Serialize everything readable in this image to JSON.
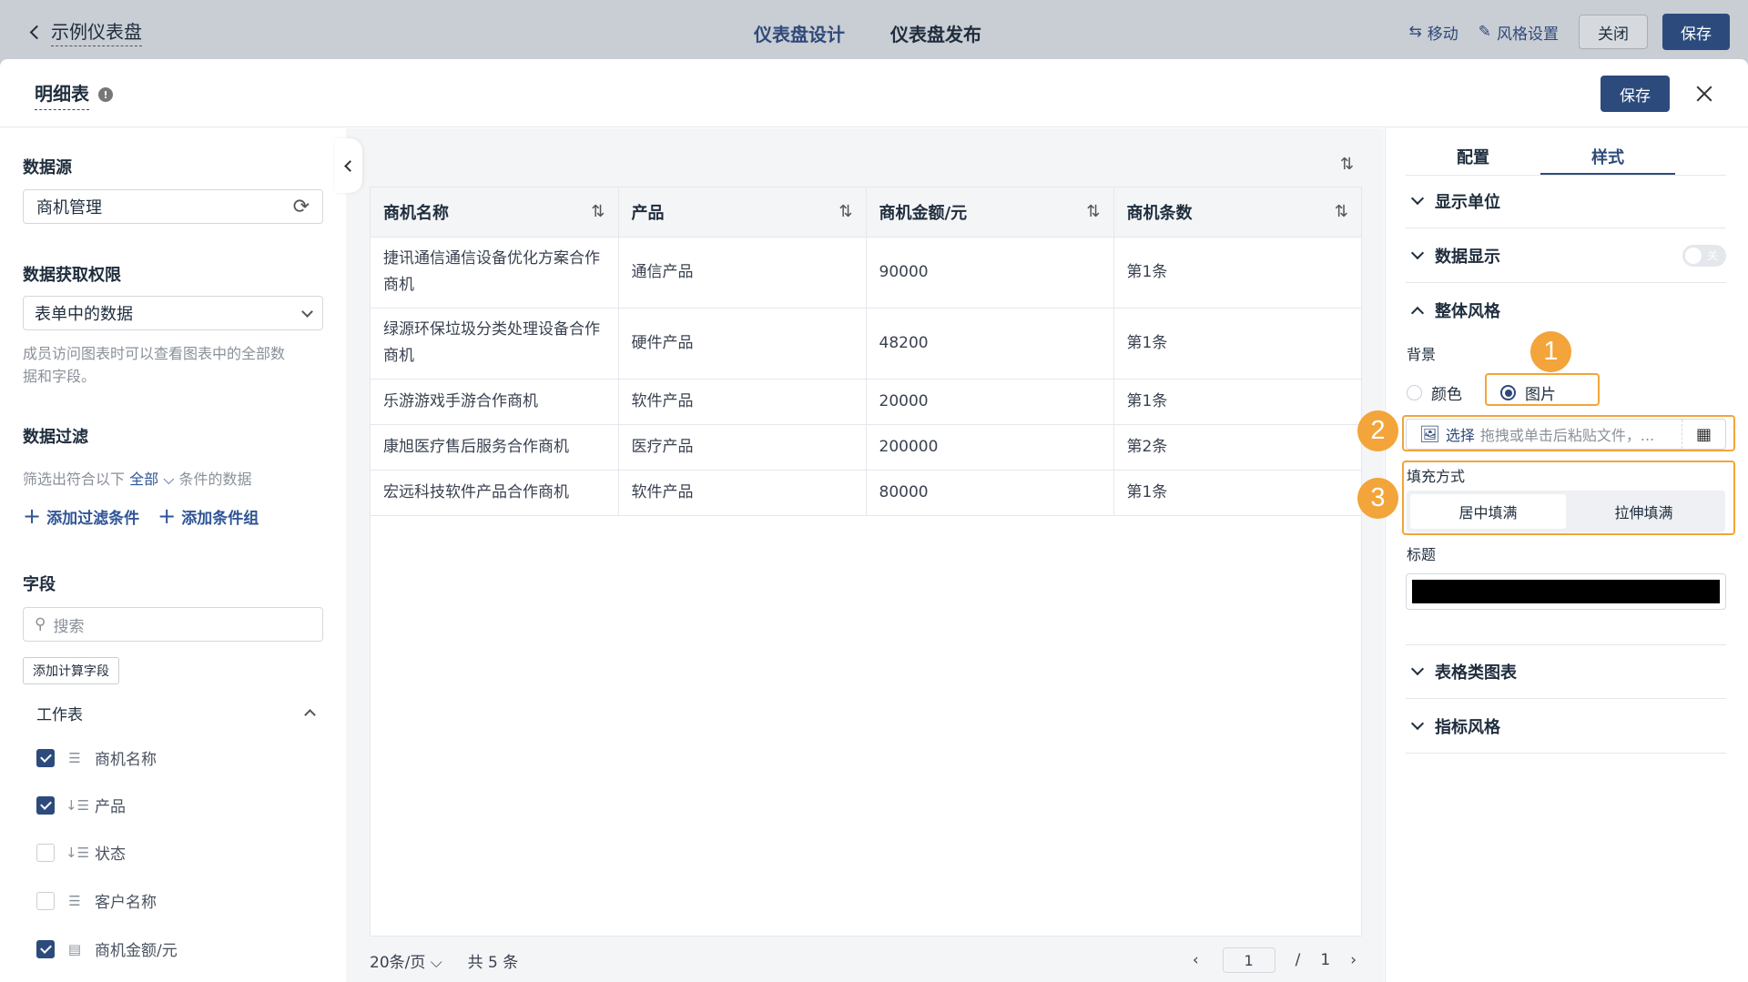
{
  "topbar": {
    "back_label": "示例仪表盘",
    "tab_design": "仪表盘设计",
    "tab_publish": "仪表盘发布",
    "move_label": "移动",
    "style_settings_label": "风格设置",
    "close_label": "关闭",
    "save_label": "保存"
  },
  "modal": {
    "title": "明细表",
    "save_label": "保存"
  },
  "left": {
    "datasource_title": "数据源",
    "datasource_value": "商机管理",
    "permission_title": "数据获取权限",
    "permission_value": "表单中的数据",
    "permission_hint_1": "成员访问图表时可以查看图表中的全部数",
    "permission_hint_2": "据和字段。",
    "filter_title": "数据过滤",
    "filter_prefix": "筛选出符合以下",
    "filter_all": "全部",
    "filter_suffix": "条件的数据",
    "add_filter": "添加过滤条件",
    "add_group": "添加条件组",
    "fields_title": "字段",
    "search_placeholder": "搜索",
    "add_calc_field": "添加计算字段",
    "worksheet_label": "工作表",
    "fields": [
      {
        "label": "商机名称",
        "checked": true,
        "icon": "text-field-icon"
      },
      {
        "label": "产品",
        "checked": true,
        "icon": "select-field-icon"
      },
      {
        "label": "状态",
        "checked": false,
        "icon": "select-field-icon"
      },
      {
        "label": "客户名称",
        "checked": false,
        "icon": "text-field-icon"
      },
      {
        "label": "商机金额/元",
        "checked": true,
        "icon": "number-field-icon"
      }
    ]
  },
  "table": {
    "headers": [
      "商机名称",
      "产品",
      "商机金额/元",
      "商机条数"
    ],
    "rows": [
      [
        "捷讯通信通信设备优化方案合作商机",
        "通信产品",
        "90000",
        "第1条"
      ],
      [
        "绿源环保垃圾分类处理设备合作商机",
        "硬件产品",
        "48200",
        "第1条"
      ],
      [
        "乐游游戏手游合作商机",
        "软件产品",
        "20000",
        "第1条"
      ],
      [
        "康旭医疗售后服务合作商机",
        "医疗产品",
        "200000",
        "第2条"
      ],
      [
        "宏远科技软件产品合作商机",
        "软件产品",
        "80000",
        "第1条"
      ]
    ]
  },
  "pager": {
    "page_size": "20条/页",
    "total": "共 5 条",
    "current_page": "1",
    "separator": "/",
    "total_pages": "1"
  },
  "right": {
    "tab_config": "配置",
    "tab_style": "样式",
    "display_unit": "显示单位",
    "data_display": "数据显示",
    "data_display_toggle": "关",
    "overall_style": "整体风格",
    "background_label": "背景",
    "bg_color": "颜色",
    "bg_image": "图片",
    "upload_select": "选择",
    "upload_hint": "拖拽或单击后粘贴文件，...",
    "fill_mode_label": "填充方式",
    "fill_center": "居中填满",
    "fill_stretch": "拉伸填满",
    "title_label": "标题",
    "table_chart": "表格类图表",
    "metric_style": "指标风格",
    "title_color": "#000000"
  },
  "annotations": [
    "1",
    "2",
    "3"
  ],
  "colors": {
    "accent": "#2c4b7c",
    "highlight": "#f3a43a"
  }
}
